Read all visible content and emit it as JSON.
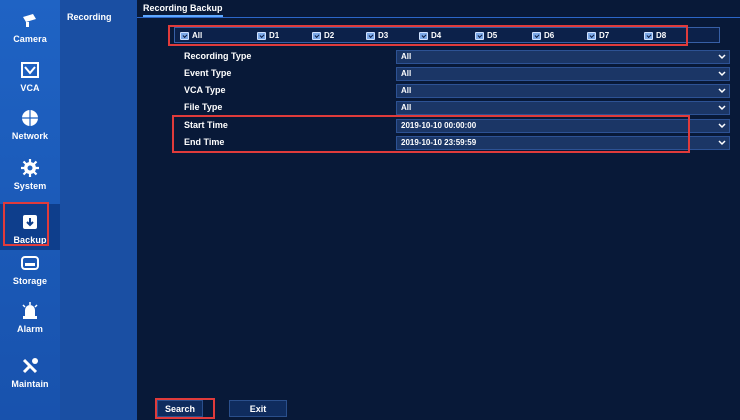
{
  "rail": {
    "items": [
      {
        "label": "Camera",
        "icon": "camera-icon"
      },
      {
        "label": "VCA",
        "icon": "vca-icon"
      },
      {
        "label": "Network",
        "icon": "network-icon"
      },
      {
        "label": "System",
        "icon": "gear-icon"
      },
      {
        "label": "Backup",
        "icon": "backup-icon",
        "active": true
      },
      {
        "label": "Storage",
        "icon": "storage-icon"
      },
      {
        "label": "Alarm",
        "icon": "alarm-icon"
      },
      {
        "label": "Maintain",
        "icon": "wrench-icon"
      }
    ]
  },
  "submenu": {
    "items": [
      {
        "label": "Recording"
      }
    ]
  },
  "tab": {
    "label": "Recording Backup"
  },
  "channels": [
    {
      "label": "All",
      "checked": true
    },
    {
      "label": "D1",
      "checked": true
    },
    {
      "label": "D2",
      "checked": true
    },
    {
      "label": "D3",
      "checked": true
    },
    {
      "label": "D4",
      "checked": true
    },
    {
      "label": "D5",
      "checked": true
    },
    {
      "label": "D6",
      "checked": true
    },
    {
      "label": "D7",
      "checked": true
    },
    {
      "label": "D8",
      "checked": true
    }
  ],
  "form": {
    "rows": [
      {
        "label": "Recording Type",
        "value": "All"
      },
      {
        "label": "Event Type",
        "value": "All"
      },
      {
        "label": "VCA Type",
        "value": "All"
      },
      {
        "label": "File Type",
        "value": "All"
      },
      {
        "label": "Start Time",
        "value": "2019-10-10 00:00:00"
      },
      {
        "label": "End Time",
        "value": "2019-10-10 23:59:59"
      }
    ]
  },
  "buttons": {
    "search": "Search",
    "exit": "Exit"
  },
  "colors": {
    "highlight": "#e03b3b",
    "rail": "#1f63c4",
    "background": "#081938"
  }
}
